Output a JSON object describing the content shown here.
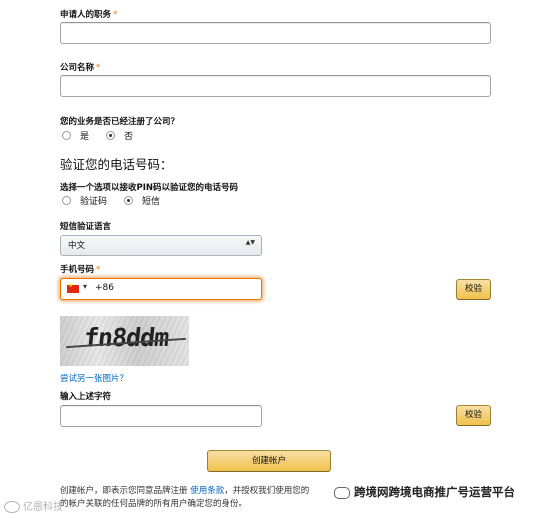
{
  "applicant_title": {
    "label": "申请人的职务",
    "required_mark": "*",
    "value": ""
  },
  "company_name": {
    "label": "公司名称",
    "required_mark": "*",
    "value": ""
  },
  "registered_question": {
    "label": "您的业务是否已经注册了公司？",
    "options": [
      "是",
      "否"
    ],
    "selected": "否"
  },
  "verify_phone": {
    "title": "验证您的电话号码：",
    "method_label": "选择一个选项以接收PIN码以验证您的电话号码",
    "options": [
      "验证码",
      "短信"
    ],
    "selected": "短信"
  },
  "sms_language": {
    "label": "短信验证语言",
    "selected": "中文",
    "arrows": "▲▼"
  },
  "phone": {
    "label": "手机号码",
    "required_mark": "*",
    "country_code": "+86",
    "dropdown_arrow": "▾",
    "value": "",
    "verify_button": "校验"
  },
  "captcha": {
    "image_text": "fn8ddm",
    "try_another": "尝试另一张图片？",
    "input_label": "输入上述字符",
    "value": "",
    "verify_button": "校验"
  },
  "create_account_button": "创建帐户",
  "terms": {
    "line1_prefix": "创建帐户，即表示您同意品牌注册",
    "terms_link": "使用条款",
    "line1_suffix": "，并授权我们使用您的",
    "line2": "的帐户关联的任何品牌的所有用户确定您的身份。"
  },
  "watermarks": {
    "bottom_left": "亿恩科技",
    "bottom_right": "跨境网跨境电商推广号运营平台"
  }
}
